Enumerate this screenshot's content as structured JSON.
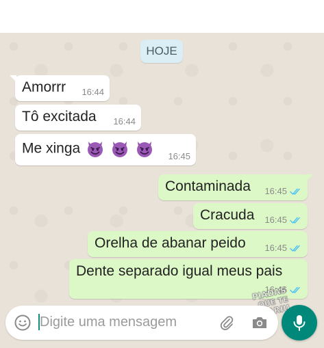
{
  "date_chip": "HOJE",
  "messages": [
    {
      "text": "Amorrr",
      "time": "16:44",
      "dir": "in"
    },
    {
      "text": "Tô excitada",
      "time": "16:44",
      "dir": "in"
    },
    {
      "text": "Me xinga",
      "time": "16:45",
      "dir": "in",
      "emoji": "smiling-devil-emoji"
    },
    {
      "text": "Contaminada",
      "time": "16:45",
      "dir": "out",
      "status": "read"
    },
    {
      "text": "Cracuda",
      "time": "16:45",
      "dir": "out",
      "status": "read"
    },
    {
      "text": "Orelha de abanar peido",
      "time": "16:45",
      "dir": "out",
      "status": "read"
    },
    {
      "text": "Dente separado igual meus pais",
      "time": "16:46",
      "dir": "out",
      "status": "read"
    }
  ],
  "input": {
    "placeholder": "Digite uma mensagem"
  },
  "icons": {
    "emoji": "emoji-icon",
    "attach": "paperclip-icon",
    "camera": "camera-icon",
    "mic": "microphone-icon",
    "read_receipt": "double-check-icon"
  },
  "watermark": "PIADAS QUE TE PARIU",
  "colors": {
    "incoming_bubble": "#ffffff",
    "outgoing_bubble": "#dcf8c6",
    "read_ticks": "#4fc3f7",
    "mic_button": "#00897b",
    "date_chip": "#dbeef5"
  }
}
